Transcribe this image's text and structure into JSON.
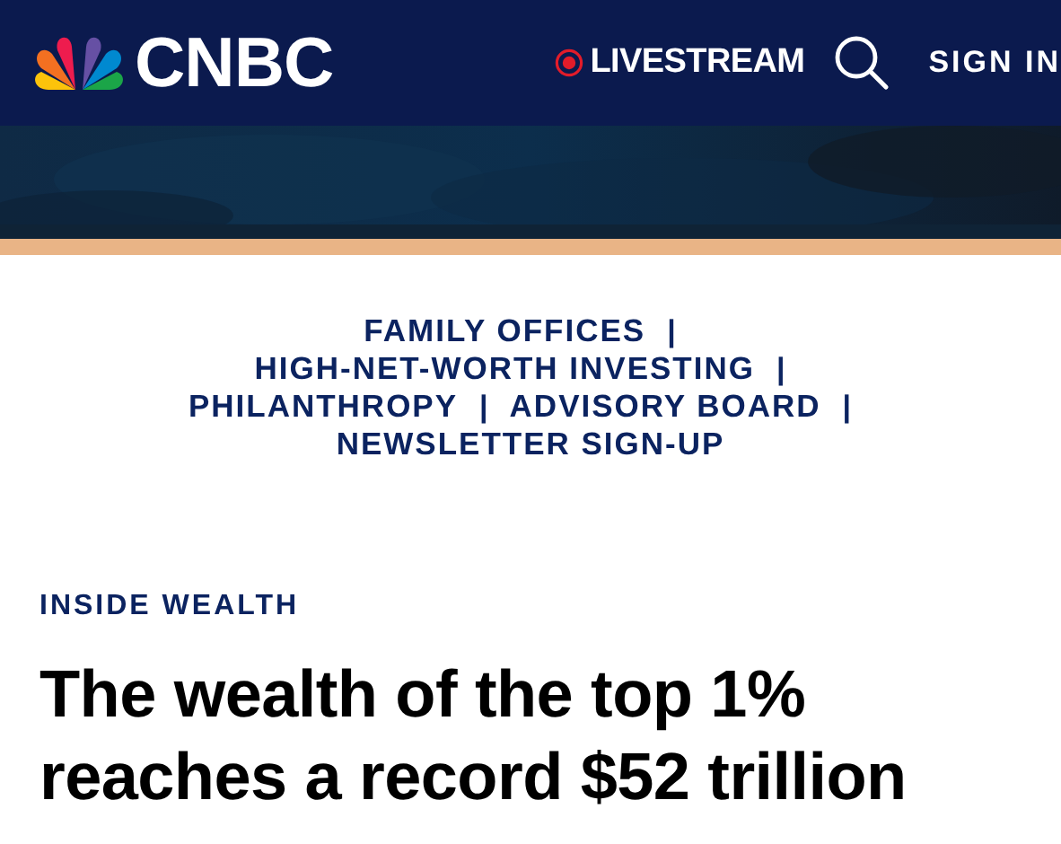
{
  "header": {
    "logo_text": "CNBC",
    "livestream": "LIVESTREAM",
    "sign_in": "SIGN IN"
  },
  "banner": {
    "kind": "picture"
  },
  "nav_lines": [
    [
      {
        "label": "FAMILY OFFICES",
        "separator": "|"
      }
    ],
    [
      {
        "label": "HIGH-NET-WORTH INVESTING",
        "separator": "|"
      }
    ],
    [
      {
        "label": "PHILANTHROPY",
        "separator": "|"
      },
      {
        "label": "ADVISORY BOARD",
        "separator": "|"
      }
    ],
    [
      {
        "label": "NEWSLETTER SIGN-UP"
      }
    ]
  ],
  "article": {
    "section": "INSIDE WEALTH",
    "headline": "The wealth of the top 1% reaches a record $52 trillion"
  }
}
